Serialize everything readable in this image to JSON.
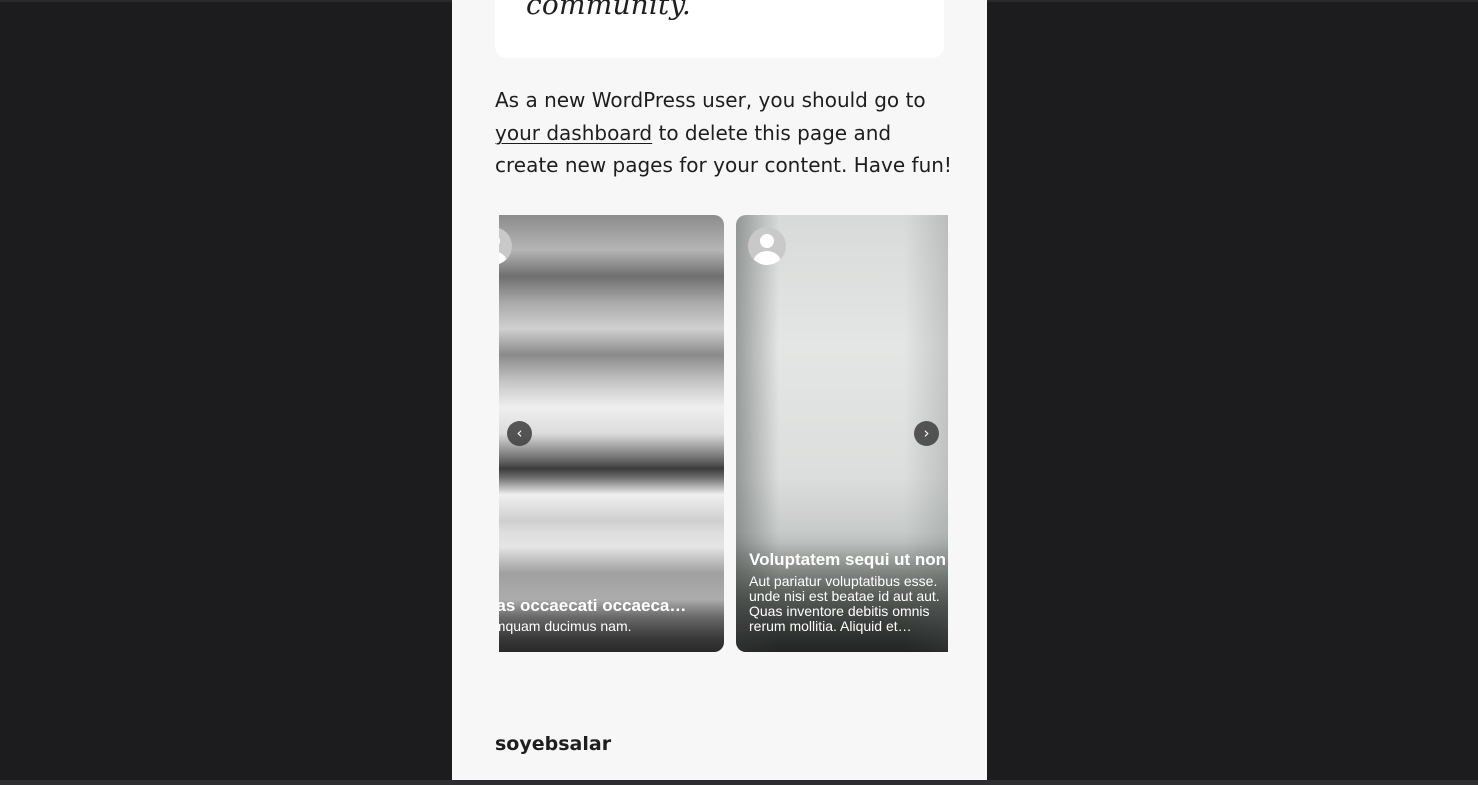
{
  "quote": {
    "text": "community."
  },
  "intro": {
    "before_link": "As a new WordPress user, you should go to ",
    "link_text": "your dashboard",
    "after_link": " to delete this page and create new pages for your content. Have fun!"
  },
  "carousel": {
    "prev_label": "‹",
    "next_label": "›",
    "slides": [
      {
        "title": "uas occaecati occaeca…",
        "excerpt": "umquam ducimus nam."
      },
      {
        "title": "Voluptatem sequi ut non",
        "excerpt": "Aut pariatur voluptatibus esse. unde nisi est beatae id aut aut. Quas inventore debitis omnis rerum mollitia. Aliquid et…"
      }
    ]
  },
  "footer": {
    "site_name": "soyebsalar"
  }
}
